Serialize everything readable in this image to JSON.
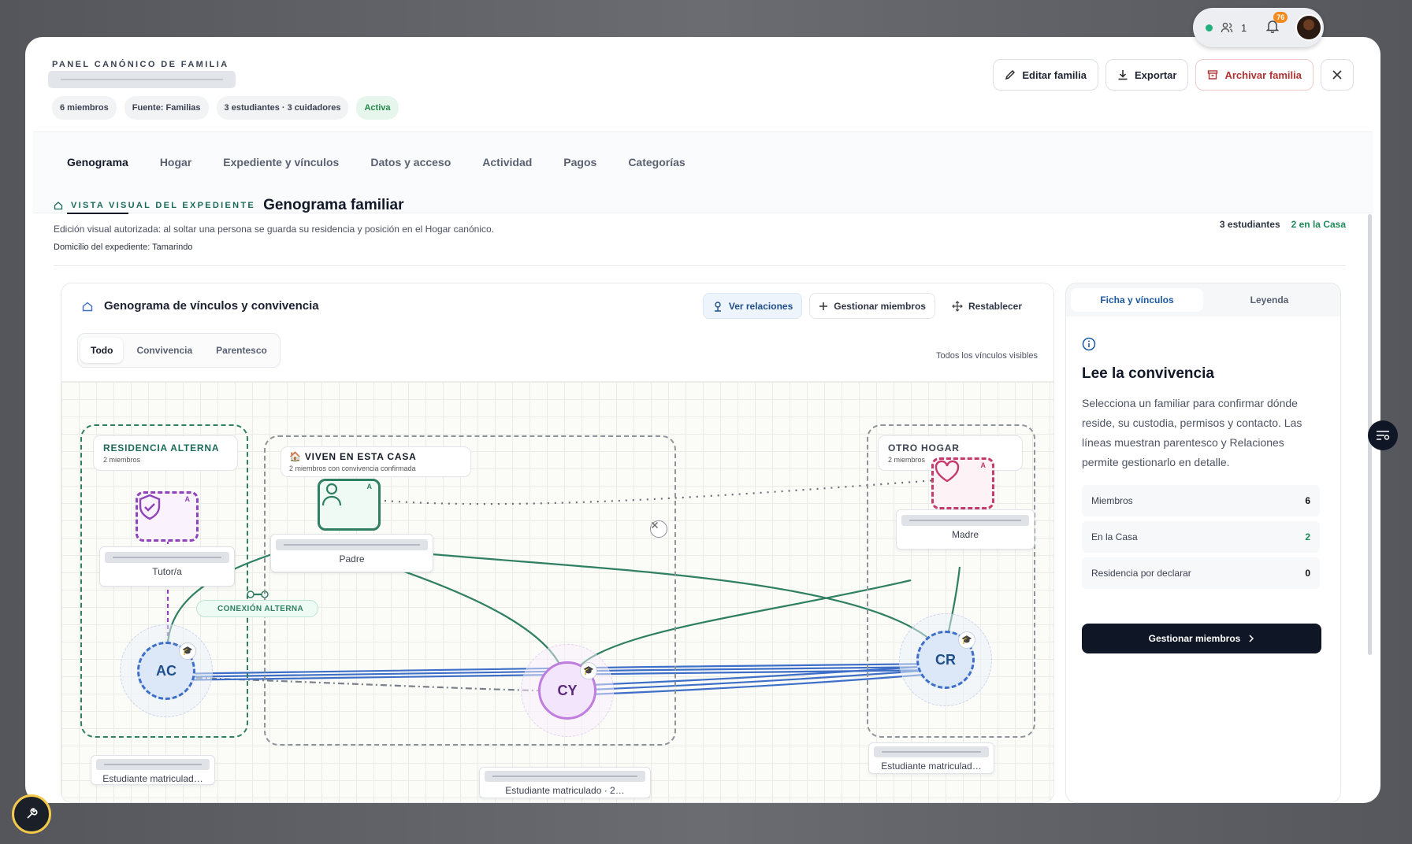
{
  "status": {
    "count": "1",
    "notif_count": "76"
  },
  "header": {
    "eyebrow": "PANEL CANÓNICO DE FAMILIA",
    "chips": [
      "6 miembros",
      "Fuente: Familias",
      "3 estudiantes · 3 cuidadores",
      "Activa"
    ],
    "buttons": {
      "edit": "Editar familia",
      "export": "Exportar",
      "archive": "Archivar familia"
    }
  },
  "tabs": [
    "Genograma",
    "Hogar",
    "Expediente y vínculos",
    "Datos y acceso",
    "Actividad",
    "Pagos",
    "Categorías"
  ],
  "section": {
    "eyebrow": "VISTA VISUAL DEL EXPEDIENTE",
    "title": "Genograma familiar",
    "description": "Edición visual autorizada: al soltar una persona se guarda su residencia y posición en el Hogar canónico.",
    "domicile": "Domicilio del expediente: Tamarindo",
    "stat_students": "3 estudiantes",
    "stat_home": "2 en la Casa"
  },
  "genogram": {
    "title": "Genograma de vínculos y convivencia",
    "buttons": {
      "relations": "Ver relaciones",
      "manage": "Gestionar miembros",
      "reset": "Restablecer"
    },
    "filters": [
      "Todo",
      "Convivencia",
      "Parentesco"
    ],
    "visible_note": "Todos los vínculos visibles",
    "groups": {
      "alt": {
        "title": "RESIDENCIA ALTERNA",
        "count": "2 miembros"
      },
      "home": {
        "title": "🏠 VIVEN EN ESTA CASA",
        "count": "2 miembros con convivencia confirmada"
      },
      "other": {
        "title": "OTRO HOGAR",
        "count": "2 miembros"
      }
    },
    "nodes": {
      "tutor": "Tutor/a",
      "padre": "Padre",
      "madre": "Madre",
      "ac": "AC",
      "cy": "CY",
      "cr": "CR",
      "ac_label": "Estudiante matriculad…",
      "cy_label": "Estudiante matriculado · 2…",
      "cr_label": "Estudiante matriculad…",
      "badge": "A",
      "alt_link": "CONEXIÓN ALTERNA"
    },
    "colors": {
      "green": "#2f7f63",
      "blue": "#3d6fc9",
      "purple": "#8e44b8",
      "pink": "#c43b6b"
    }
  },
  "side": {
    "tabs": [
      "Ficha y vínculos",
      "Leyenda"
    ],
    "title": "Lee la convivencia",
    "text": "Selecciona un familiar para confirmar dónde reside, su custodia, permisos y contacto. Las líneas muestran parentesco y Relaciones permite gestionarlo en detalle.",
    "rows": [
      {
        "label": "Miembros",
        "value": "6"
      },
      {
        "label": "En la Casa",
        "value": "2"
      },
      {
        "label": "Residencia por declarar",
        "value": "0"
      }
    ],
    "button": "Gestionar miembros"
  }
}
